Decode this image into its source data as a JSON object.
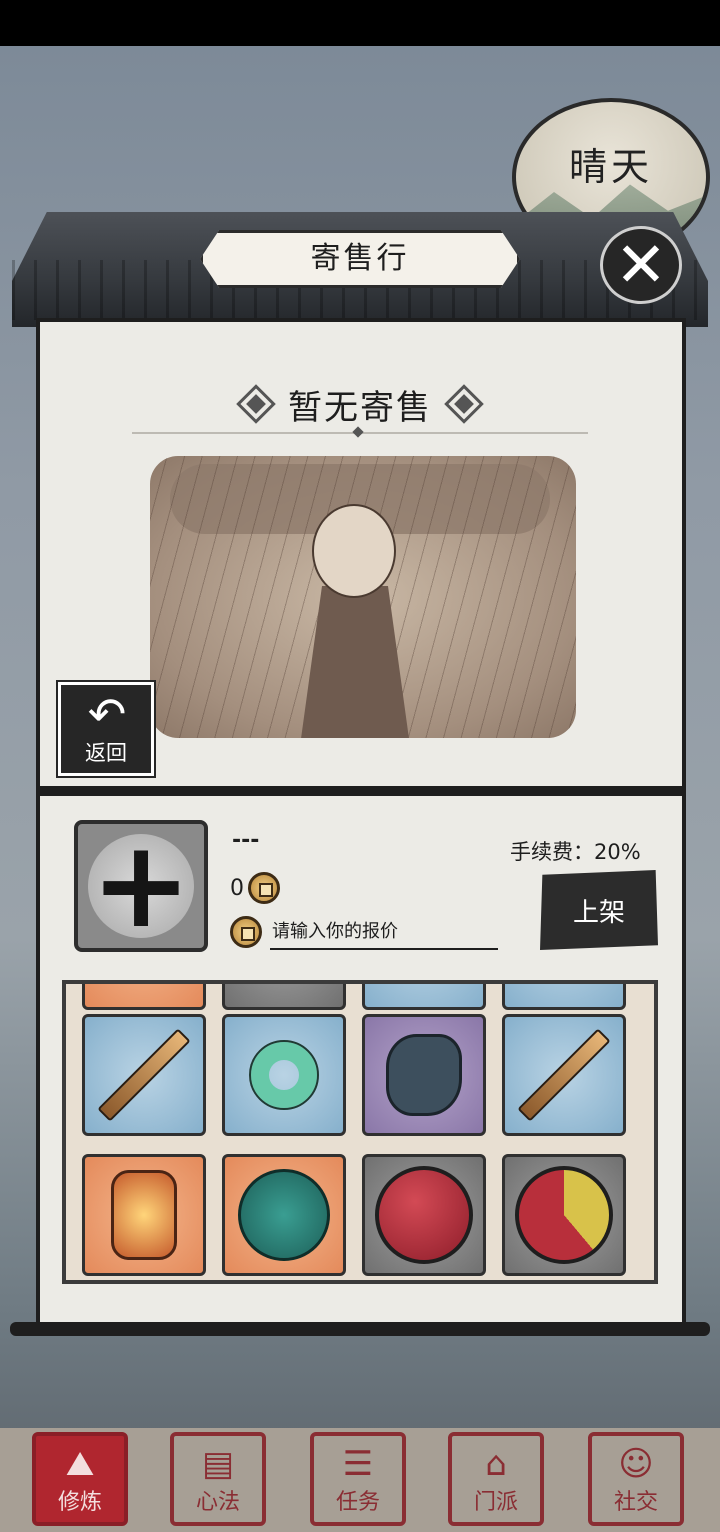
{
  "weather": {
    "label": "晴天"
  },
  "window": {
    "title": "寄售行",
    "close_icon": "close-icon"
  },
  "empty_state": {
    "title": "暂无寄售"
  },
  "back_button": {
    "label": "返回"
  },
  "listing": {
    "item_name": "---",
    "price_value": "0",
    "bid_placeholder": "请输入你的报价",
    "fee_text": "手续费：20%",
    "list_button_label": "上架"
  },
  "inventory": {
    "rows": [
      [
        "orange",
        "gray",
        "blue",
        "blue"
      ],
      [
        "sword-icon",
        "jade-pendant-icon",
        "ore-icon",
        "sword-icon"
      ],
      [
        "lantern-icon",
        "jade-orb-icon",
        "red-pill-icon",
        "yin-yang-pill-icon"
      ]
    ]
  },
  "bottom_nav": {
    "items": [
      {
        "label": "修炼",
        "icon": "mountain-icon",
        "active": true
      },
      {
        "label": "心法",
        "icon": "scroll-icon",
        "active": false
      },
      {
        "label": "任务",
        "icon": "task-icon",
        "active": false
      },
      {
        "label": "门派",
        "icon": "sect-icon",
        "active": false
      },
      {
        "label": "社交",
        "icon": "people-icon",
        "active": false
      }
    ]
  }
}
